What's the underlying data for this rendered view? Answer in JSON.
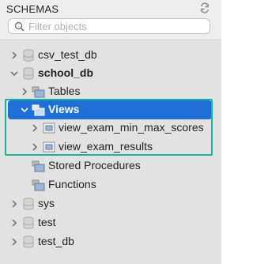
{
  "header": {
    "title": "SCHEMAS"
  },
  "search": {
    "placeholder": "Filter objects",
    "value": ""
  },
  "tree": {
    "csv_test_db": "csv_test_db",
    "school_db": "school_db",
    "tables": "Tables",
    "views": "Views",
    "view1": "view_exam_min_max_scores",
    "view2": "view_exam_results",
    "stored_procedures": "Stored Procedures",
    "functions": "Functions",
    "sys": "sys",
    "test": "test",
    "test_db": "test_db"
  },
  "colors": {
    "selection": "#1f6fd6",
    "highlight_frame": "#19b39a"
  }
}
